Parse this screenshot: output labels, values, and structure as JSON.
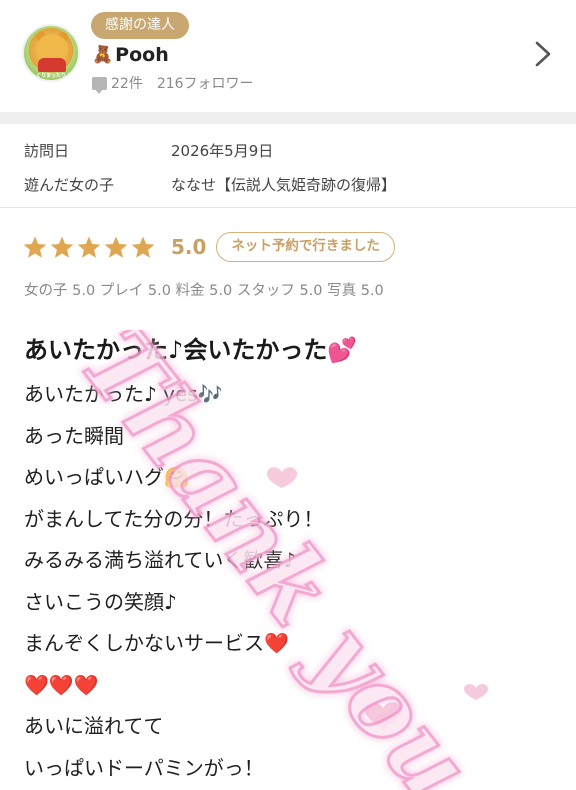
{
  "profile": {
    "badge": "感謝の達人",
    "avatar_text": "ゆっくりまったりよろしく",
    "name_emoji": "🧸",
    "name": "Pooh",
    "review_count": "22件",
    "followers": "216フォロワー"
  },
  "visit": {
    "date_label": "訪問日",
    "date_value": "2026年5月9日",
    "girl_label": "遊んだ女の子",
    "girl_value": "ななせ【伝説人気姫奇跡の復帰】"
  },
  "rating": {
    "stars": 5,
    "score": "5.0",
    "reservation_badge": "ネット予約で行きました",
    "sub_scores": "女の子 5.0  プレイ 5.0  料金 5.0  スタッフ 5.0  写真 5.0"
  },
  "review": {
    "title": "あいたかった♪会いたかった💕",
    "lines": [
      "あいたかった♪    yes🎶",
      "あった瞬間",
      "めいっぱいハグ🤗",
      "がまんしてた分の分！たっぷり！",
      "みるみる満ち溢れていく歓喜♪",
      "さいこうの笑顔♪",
      "まんぞくしかないサービス❤️",
      "❤️❤️❤️",
      "あいに溢れてて",
      "いっぱいドーパミンがっ！"
    ]
  },
  "watermark": "Thank you",
  "colors": {
    "gold": "#c9a063",
    "badge_bg": "#c8a870",
    "star": "#e0a752",
    "watermark_pink": "#f7b8dc"
  }
}
